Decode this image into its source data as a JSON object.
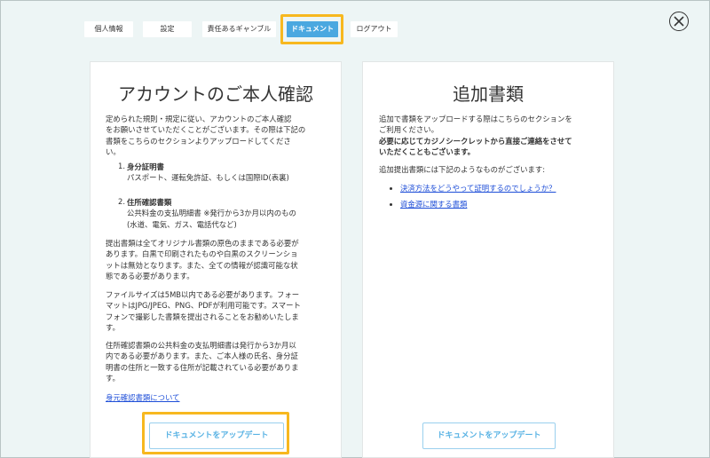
{
  "nav": {
    "tabs": [
      "個人情報",
      "設定",
      "責任あるギャンブル",
      "ドキュメント",
      "ログアウト"
    ],
    "active_tab": "ドキュメント"
  },
  "left": {
    "title": "アカウントのご本人確認",
    "intro": [
      "定められた規則・規定に従い、アカウントのご本人確認",
      "をお願いさせていただくことがございます。その際は下記の",
      "書類をこちらのセクションよりアップロードしてくださ",
      "い。"
    ],
    "items": [
      {
        "num": "1.",
        "title": "身分証明書",
        "desc": [
          "パスポート、運転免許証、もしくは国際ID(表裏)"
        ]
      },
      {
        "num": "2.",
        "title": "住所確認書類",
        "desc": [
          "公共料金の支払明細書 ※発行から3か月以内のもの",
          "(水道、電気、ガス、電話代など)"
        ]
      }
    ],
    "para1": [
      "提出書類は全てオリジナル書類の原色のままである必要が",
      "あります。白黒で印刷されたものや白黒のスクリーンショ",
      "ットは無効となります。また、全ての情報が認識可能な状",
      "態である必要があります。"
    ],
    "para2": [
      "ファイルサイズは5MB以内である必要があります。フォー",
      "マットはJPG/JPEG、PNG、PDFが利用可能です。スマート",
      "フォンで撮影した書類を提出されることをお勧めいたしま",
      "す。"
    ],
    "para3": [
      "住所確認書類の公共料金の支払明細書は発行から3か月以",
      "内である必要があります。また、ご本人様の氏名、身分証",
      "明書の住所と一致する住所が記載されている必要がありま",
      "す。"
    ],
    "link": "身元確認書類について",
    "button": "ドキュメントをアップデート"
  },
  "right": {
    "title": "追加書類",
    "intro": [
      "追加で書類をアップロードする際はこちらのセクションを",
      "ご利用ください。"
    ],
    "bold": [
      "必要に応じてカジノシークレットから直接ご連絡をさせて",
      "いただくこともございます。"
    ],
    "list_intro": "追加提出書類には下記のようなものがございます:",
    "links": [
      "決済方法をどうやって証明するのでしょうか？",
      "資金源に関する書類"
    ],
    "button": "ドキュメントをアップデート"
  }
}
